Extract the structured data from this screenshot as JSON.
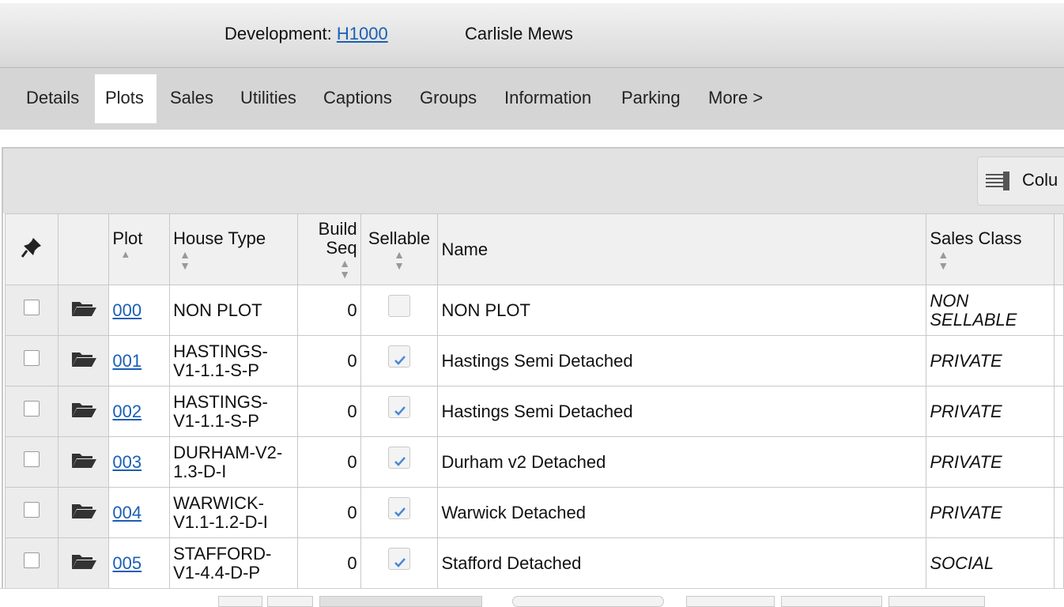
{
  "header": {
    "dev_label": "Development:",
    "dev_code": "H1000",
    "dev_name": "Carlisle Mews"
  },
  "tabs": [
    {
      "label": "Details"
    },
    {
      "label": "Plots",
      "active": true
    },
    {
      "label": "Sales"
    },
    {
      "label": "Utilities"
    },
    {
      "label": "Captions"
    },
    {
      "label": "Groups"
    },
    {
      "label": "Information"
    },
    {
      "label": "Parking"
    },
    {
      "label": "More >"
    }
  ],
  "toolbar": {
    "columns_label": "Colu",
    "columns_icon": "columns-icon"
  },
  "table": {
    "headers": {
      "pin_icon": "pin-icon",
      "plot": "Plot",
      "house_type": "House Type",
      "build_seq_1": "Build",
      "build_seq_2": "Seq",
      "sellable": "Sellable",
      "name": "Name",
      "sales_class": "Sales Class"
    },
    "rows": [
      {
        "plot": "000",
        "house_type_1": "NON PLOT",
        "house_type_2": "",
        "build_seq": "0",
        "sellable": false,
        "name": "NON PLOT",
        "sales_class_1": "NON",
        "sales_class_2": "SELLABLE"
      },
      {
        "plot": "001",
        "house_type_1": "HASTINGS-",
        "house_type_2": "V1-1.1-S-P",
        "build_seq": "0",
        "sellable": true,
        "name": "Hastings Semi Detached",
        "sales_class_1": "PRIVATE",
        "sales_class_2": ""
      },
      {
        "plot": "002",
        "house_type_1": "HASTINGS-",
        "house_type_2": "V1-1.1-S-P",
        "build_seq": "0",
        "sellable": true,
        "name": "Hastings Semi Detached",
        "sales_class_1": "PRIVATE",
        "sales_class_2": ""
      },
      {
        "plot": "003",
        "house_type_1": "DURHAM-V2-",
        "house_type_2": "1.3-D-I",
        "build_seq": "0",
        "sellable": true,
        "name": "Durham v2 Detached",
        "sales_class_1": "PRIVATE",
        "sales_class_2": ""
      },
      {
        "plot": "004",
        "house_type_1": "WARWICK-",
        "house_type_2": "V1.1-1.2-D-I",
        "build_seq": "0",
        "sellable": true,
        "name": "Warwick Detached",
        "sales_class_1": "PRIVATE",
        "sales_class_2": ""
      },
      {
        "plot": "005",
        "house_type_1": "STAFFORD-",
        "house_type_2": "V1-4.4-D-P",
        "build_seq": "0",
        "sellable": true,
        "name": "Stafford Detached",
        "sales_class_1": "SOCIAL",
        "sales_class_2": ""
      }
    ]
  }
}
